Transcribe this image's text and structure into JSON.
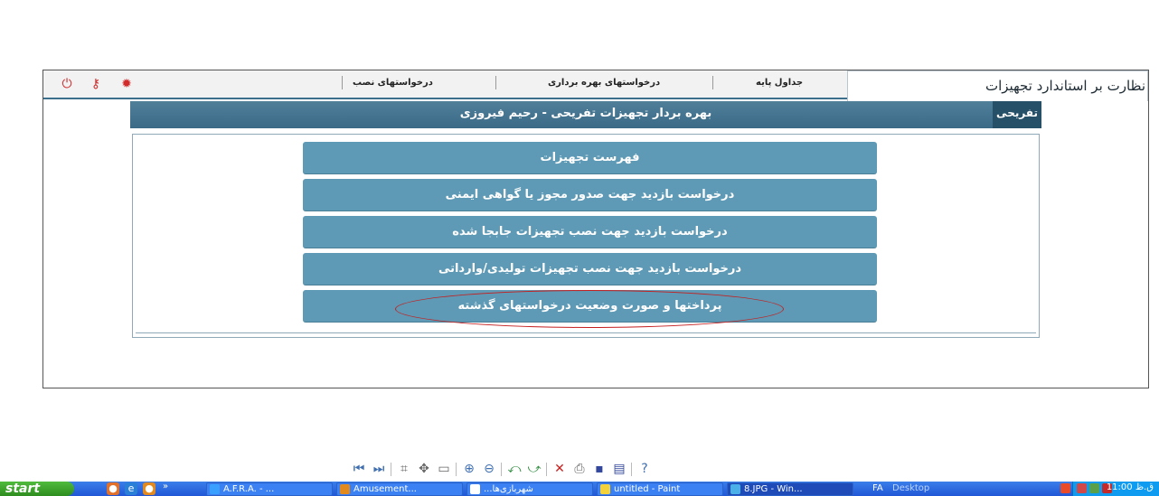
{
  "app": {
    "title": "نظارت بر استاندارد تجهیزات",
    "tabs": [
      {
        "label": "جداول پایه"
      },
      {
        "label": "درخواستهای بهره بردارى"
      },
      {
        "label": "درخواستهای نصب"
      }
    ],
    "tool_icons": [
      "settings-icon",
      "key-icon",
      "power-icon"
    ]
  },
  "header": {
    "title": "بهره بردار تجهیزات تفریحی - رحیم فیروزی",
    "side_tab": "تفریحی"
  },
  "menu": {
    "items": [
      {
        "label": "فهرست تجهیزات"
      },
      {
        "label": "درخواست بازدید جهت صدور مجوز یا گواهی ایمنی"
      },
      {
        "label": "درخواست بازدید جهت نصب تجهیزات جابجا شده"
      },
      {
        "label": "درخواست بازدید جهت نصب تجهیزات تولیدی/وارداتی"
      },
      {
        "label": "پرداختها و صورت وضعیت درخواستهای گذشته"
      }
    ],
    "highlighted_index": 4
  },
  "viewer_toolbar": {
    "icons": [
      "previous-icon",
      "next-icon",
      "actual-size-icon",
      "fit-icon",
      "slideshow-icon",
      "zoom-in-icon",
      "zoom-out-icon",
      "rotate-left-icon",
      "rotate-right-icon",
      "delete-icon",
      "print-icon",
      "save-icon",
      "edit-icon",
      "help-icon"
    ]
  },
  "taskbar": {
    "start_label": "start",
    "overflow_marker": "»",
    "buttons": [
      {
        "label": "A.F.R.A. - ...",
        "icon": "ie-icon"
      },
      {
        "label": "Amusement...",
        "icon": "firefox-icon"
      },
      {
        "label": "...شهربازی‌ها",
        "icon": "word-icon"
      },
      {
        "label": "untitled - Paint",
        "icon": "paint-icon"
      },
      {
        "label": "8.JPG - Win...",
        "icon": "image-viewer-icon"
      }
    ],
    "language": "FA",
    "desktop_label": "Desktop",
    "clock": "11:00 ق.ظ"
  },
  "colors": {
    "header_bar": "#3a6a86",
    "button": "#5e9ab5",
    "highlight_ring": "#c41f1f",
    "taskbar": "#2157d6",
    "start": "#2e8d1f"
  }
}
